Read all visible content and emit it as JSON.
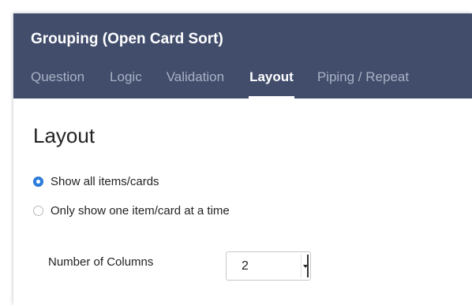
{
  "header": {
    "title": "Grouping (Open Card Sort)",
    "tabs": [
      {
        "label": "Question",
        "active": false
      },
      {
        "label": "Logic",
        "active": false
      },
      {
        "label": "Validation",
        "active": false
      },
      {
        "label": "Layout",
        "active": true
      },
      {
        "label": "Piping / Repeat",
        "active": false
      }
    ]
  },
  "content": {
    "title": "Layout",
    "radio_options": [
      {
        "label": "Show all items/cards",
        "checked": true
      },
      {
        "label": "Only show one item/card at a time",
        "checked": false
      }
    ],
    "columns_field": {
      "label": "Number of Columns",
      "value": "2"
    }
  },
  "colors": {
    "header_bg": "#414d6b",
    "tab_inactive": "#a9b1c5",
    "tab_active": "#ffffff",
    "radio_checked": "#2e7ee0"
  },
  "icons": {
    "radio_checked": "radio-checked-icon",
    "radio_unchecked": "radio-unchecked-icon",
    "select_arrow": "chevron-down-icon"
  }
}
